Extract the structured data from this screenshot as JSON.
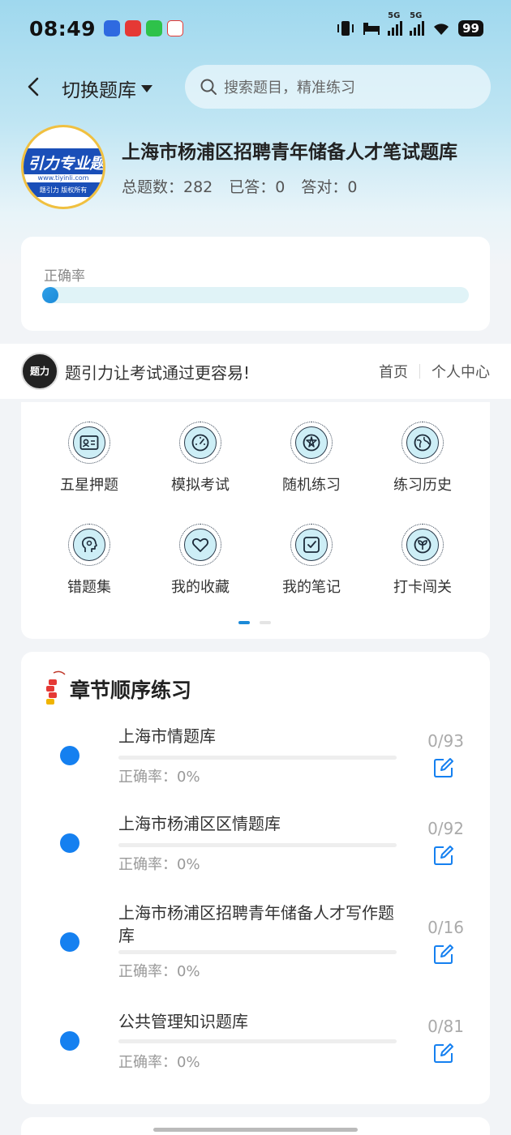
{
  "status_bar": {
    "time": "08:49",
    "network_1": "5G",
    "network_2": "5G",
    "battery": "99",
    "app_icons": [
      "u-app-icon",
      "xiaohongshu-icon",
      "wechat-icon",
      "red-app-icon"
    ]
  },
  "header": {
    "switch_label": "切换题库",
    "search_placeholder": "搜索题目，精准练习"
  },
  "profile": {
    "logo_text": "引力专业题",
    "logo_url": "www.tiyinli.com",
    "logo_footer": "题引力 版权所有",
    "title": "上海市杨浦区招聘青年储备人才笔试题库",
    "total_label": "总题数：282",
    "answered_label": "已答：0",
    "correct_label": "答对：0"
  },
  "accuracy": {
    "label": "正确率",
    "value_fraction": 0
  },
  "promo": {
    "logo_text": "题力",
    "text": "题引力让考试通过更容易!",
    "link_home": "首页",
    "link_profile": "个人中心"
  },
  "features": [
    {
      "label": "五星押题",
      "icon": "id-card-icon"
    },
    {
      "label": "模拟考试",
      "icon": "speedometer-icon"
    },
    {
      "label": "随机练习",
      "icon": "network-icon"
    },
    {
      "label": "练习历史",
      "icon": "globe-icon"
    },
    {
      "label": "错题集",
      "icon": "head-icon"
    },
    {
      "label": "我的收藏",
      "icon": "heart-icon"
    },
    {
      "label": "我的笔记",
      "icon": "note-check-icon"
    },
    {
      "label": "打卡闯关",
      "icon": "sprout-icon"
    }
  ],
  "chapters": {
    "title": "章节顺序练习",
    "items": [
      {
        "name": "上海市情题库",
        "accuracy": "正确率：0%",
        "count": "0/93"
      },
      {
        "name": "上海市杨浦区区情题库",
        "accuracy": "正确率：0%",
        "count": "0/92"
      },
      {
        "name": "上海市杨浦区招聘青年储备人才写作题库",
        "accuracy": "正确率：0%",
        "count": "0/16"
      },
      {
        "name": "公共管理知识题库",
        "accuracy": "正确率：0%",
        "count": "0/81"
      }
    ]
  },
  "colors": {
    "accent": "#1580f0",
    "icon_bg": "#cdeef6",
    "track": "#e0f3f7"
  }
}
